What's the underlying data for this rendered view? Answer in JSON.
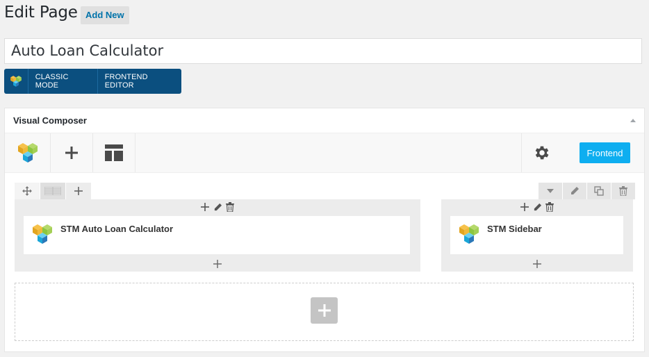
{
  "header": {
    "title": "Edit Page",
    "add_new_label": "Add New"
  },
  "post_title": {
    "value": "Auto Loan Calculator"
  },
  "mode_bar": {
    "classic_label": "CLASSIC MODE",
    "frontend_editor_label": "FRONTEND EDITOR"
  },
  "composer": {
    "box_title": "Visual Composer",
    "nav": {
      "logo_icon": "vc-logo-icon",
      "add_icon": "plus-icon",
      "templates_icon": "layout-icon",
      "settings_icon": "gear-icon",
      "frontend_label": "Frontend"
    },
    "columns": [
      {
        "element_title": "STM Auto Loan Calculator"
      },
      {
        "element_title": "STM Sidebar"
      }
    ]
  },
  "colors": {
    "mode_bar_bg": "#0b4f7f",
    "frontend_btn_bg": "#0eaef0",
    "link": "#0073aa"
  }
}
